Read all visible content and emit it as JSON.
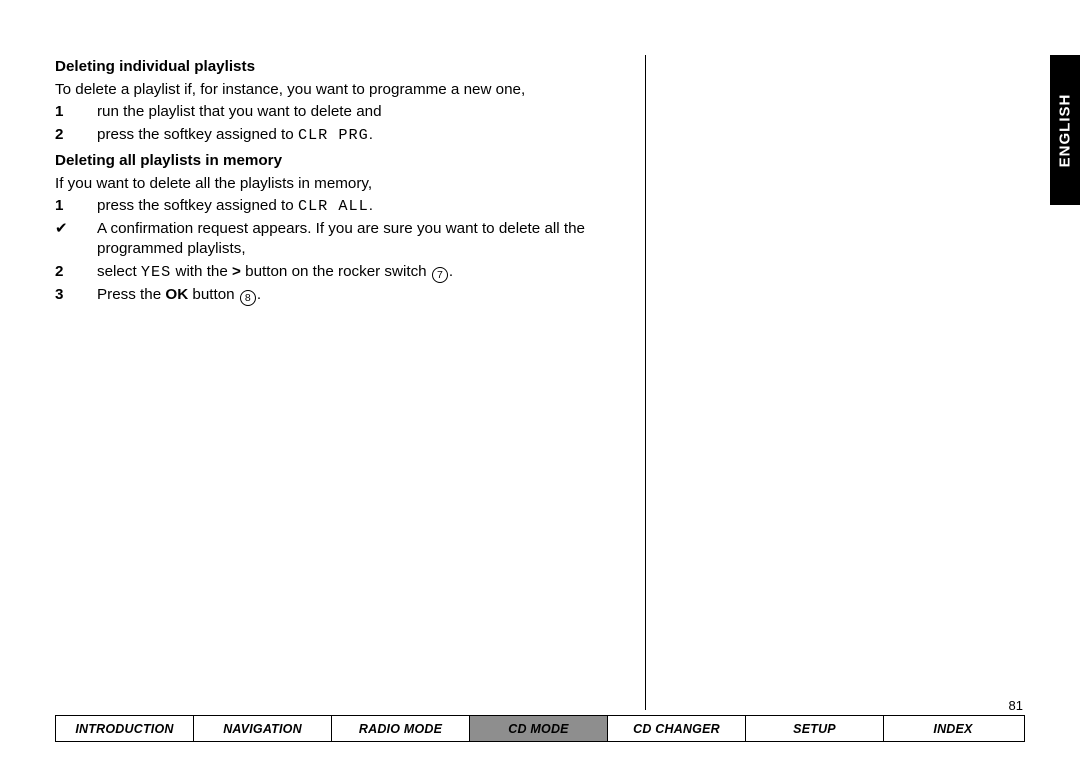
{
  "language_tab": "ENGLISH",
  "page_number": "81",
  "section1": {
    "heading": "Deleting individual playlists",
    "intro": "To delete a playlist if, for instance, you want to programme a new one,",
    "step1_marker": "1",
    "step1_text": "run the playlist that you want to delete and",
    "step2_marker": "2",
    "step2_prefix": "press the softkey assigned to ",
    "step2_code": "CLR PRG",
    "step2_suffix": "."
  },
  "section2": {
    "heading": "Deleting all playlists in memory",
    "intro": "If you want to delete all the playlists in memory,",
    "step1_marker": "1",
    "step1_prefix": "press the softkey assigned to ",
    "step1_code": "CLR ALL",
    "step1_suffix": ".",
    "check_marker": "✔",
    "check_text": "A confirmation request appears. If you are sure you want to delete all the programmed playlists,",
    "step2_marker": "2",
    "step2_a": "select ",
    "step2_code": "YES",
    "step2_b": " with the ",
    "step2_gt": ">",
    "step2_c": " button on the rocker switch ",
    "step2_circ": "7",
    "step2_d": ".",
    "step3_marker": "3",
    "step3_a": "Press the ",
    "step3_ok": "OK",
    "step3_b": " button ",
    "step3_circ": "8",
    "step3_c": "."
  },
  "tabs": {
    "intro": "INTRODUCTION",
    "nav": "NAVIGATION",
    "radio": "RADIO MODE",
    "cd": "CD MODE",
    "chg": "CD CHANGER",
    "setup": "SETUP",
    "index": "INDEX"
  }
}
